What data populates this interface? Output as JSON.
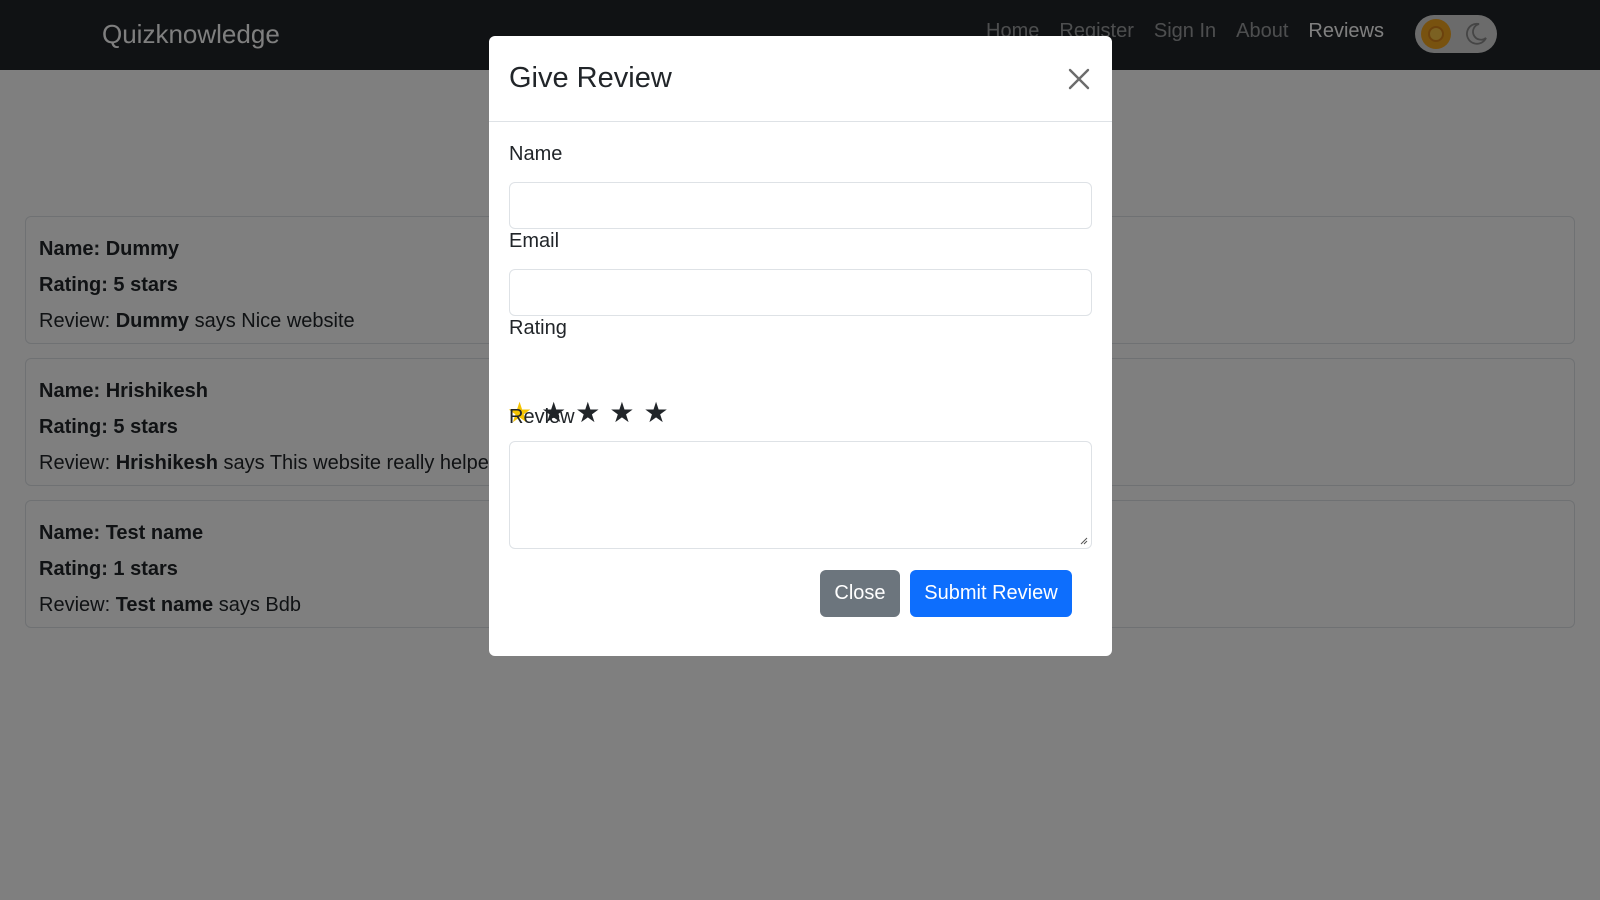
{
  "navbar": {
    "brand": "Quizknowledge",
    "links": [
      "Home",
      "Register",
      "Sign In",
      "About",
      "Reviews"
    ],
    "active": "Reviews",
    "theme_toggle": {
      "light_icon": "sun-icon",
      "dark_icon": "moon-icon"
    }
  },
  "reviews": [
    {
      "name_line": "Name: Dummy",
      "rating_line": "Rating: 5 stars",
      "review_prefix": "Review: ",
      "review_name": "Dummy",
      "review_text": " says Nice website"
    },
    {
      "name_line": "Name: Hrishikesh",
      "rating_line": "Rating: 5 stars",
      "review_prefix": "Review: ",
      "review_name": "Hrishikesh",
      "review_text": " says This website really helped"
    },
    {
      "name_line": "Name: Test name",
      "rating_line": "Rating: 1 stars",
      "review_prefix": "Review: ",
      "review_name": "Test name",
      "review_text": " says Bdb"
    }
  ],
  "modal": {
    "title": "Give Review",
    "fields": {
      "name_label": "Name",
      "name_value": "",
      "email_label": "Email",
      "email_value": "",
      "rating_label": "Rating",
      "rating_value": 1,
      "rating_max": 5,
      "review_label": "Review",
      "review_value": ""
    },
    "buttons": {
      "close": "Close",
      "submit": "Submit Review"
    },
    "colors": {
      "star_active": "#f5c400",
      "star_inactive": "#212529",
      "close_button": "#6c757d",
      "submit_button": "#0d6efd"
    }
  }
}
